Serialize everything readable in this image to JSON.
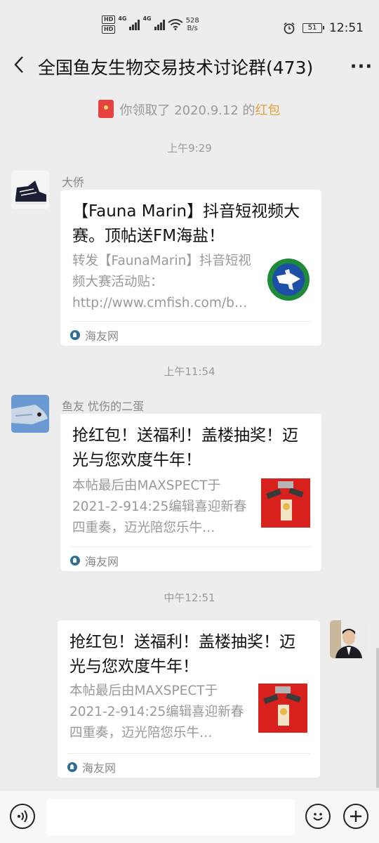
{
  "status": {
    "hd1": "HD",
    "hd2": "HD",
    "net_type": "4G",
    "net_type2": "4G",
    "speed_value": "528",
    "speed_unit": "B/s",
    "battery": "51",
    "time": "12:51"
  },
  "header": {
    "title": "全国鱼友生物交易技术讨论群(473)"
  },
  "system_notice": {
    "prefix": "你领取了 2020.9.12 的",
    "link": "红包"
  },
  "messages": [
    {
      "timestamp": "上午9:29",
      "sender": "大侨",
      "title": "【Fauna Marin】抖音短视频大赛。顶帖送FM海盐！",
      "desc": "转发【FaunaMarin】抖音短视频大赛活动贴：http://www.cmfish.com/b…",
      "source": "海友网",
      "thumb": "fauna-marin-logo"
    },
    {
      "timestamp": "上午11:54",
      "sender": "鱼友 忧伤的二蛋",
      "title": "抢红包！送福利！盖楼抽奖！迈光与您欢度牛年！",
      "desc": "本帖最后由MAXSPECT于2021-2-914:25编辑喜迎新春四重奏，迈光陪您乐牛…",
      "source": "海友网",
      "thumb": "maxspect-red-banner"
    },
    {
      "timestamp": "中午12:51",
      "sender": "",
      "title": "抢红包！送福利！盖楼抽奖！迈光与您欢度牛年！",
      "desc": "本帖最后由MAXSPECT于2021-2-914:25编辑喜迎新春四重奏，迈光陪您乐牛…",
      "source": "海友网",
      "thumb": "maxspect-red-banner"
    }
  ],
  "icons": {
    "back": "chevron-left-icon",
    "more": "more-dots-icon",
    "voice": "voice-icon",
    "emoji": "emoji-icon",
    "add": "plus-icon"
  },
  "colors": {
    "background": "#ededed",
    "bubble": "#ffffff",
    "red_packet_link": "#e6a23c",
    "red_packet": "#e64340"
  }
}
